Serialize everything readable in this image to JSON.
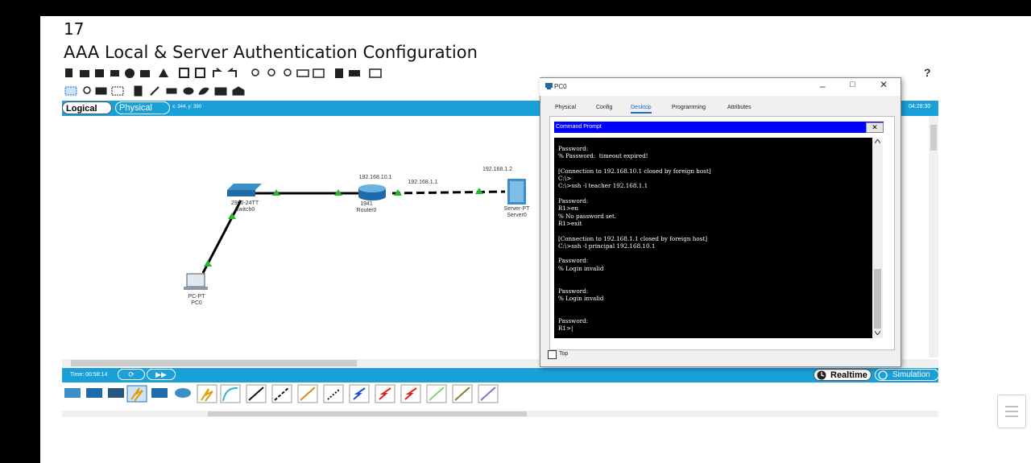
{
  "doc": {
    "page_number": "17",
    "title": "AAA Local & Server Authentication Configuration"
  },
  "toolbar": {
    "help": "?"
  },
  "mode_bar": {
    "logical": "Logical",
    "physical": "Physical",
    "coords": "x: 344, y: 390",
    "clock": "04:28:30"
  },
  "devices": {
    "switch": {
      "model": "2960-24TT",
      "name": "Switch0"
    },
    "router": {
      "model": "1941",
      "name": "Router0",
      "ip": "192.168.10.1"
    },
    "server": {
      "model": "Server-PT",
      "name": "Server0",
      "ip": "192.168.1.2"
    },
    "pc": {
      "model": "PC-PT",
      "name": "PC0"
    },
    "link_ip": "192.168.1.1"
  },
  "time_bar": {
    "time": "Time: 00:58:14",
    "realtime": "Realtime",
    "simulation": "Simulation"
  },
  "pc_window": {
    "title": "PC0",
    "tabs": [
      "Physical",
      "Config",
      "Desktop",
      "Programming",
      "Attributes"
    ],
    "cmd_title": "Command Prompt",
    "top_label": "Top",
    "terminal_lines": [
      "Password:",
      "% Password:  timeout expired!",
      "",
      "[Connection to 192.168.10.1 closed by foreign host]",
      "C:\\>",
      "C:\\>ssh -l teacher 192.168.1.1",
      "",
      "Password:",
      "R1>en",
      "% No password set.",
      "R1>exit",
      "",
      "[Connection to 192.168.1.1 closed by foreign host]",
      "C:\\>ssh -l principal 192.168.10.1",
      "",
      "Password:",
      "% Login invalid",
      "",
      "",
      "Password:",
      "% Login invalid",
      "",
      "",
      "Password:",
      "R1>|"
    ]
  },
  "colors": {
    "accent": "#1aa0d8",
    "link_green": "#2bb52b",
    "cmd_header": "#0000ff"
  }
}
